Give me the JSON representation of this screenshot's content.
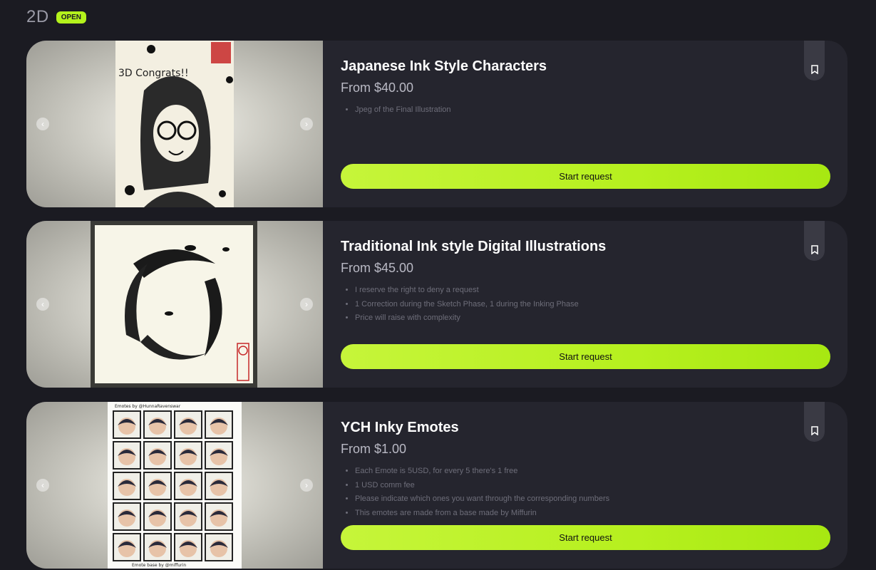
{
  "section": {
    "title": "2D",
    "status": "OPEN"
  },
  "colors": {
    "accent": "#b4f21c",
    "card_bg": "#25252e",
    "page_bg": "#1b1b22"
  },
  "cards": [
    {
      "title": "Japanese Ink Style Characters",
      "price": "From $40.00",
      "bullets": [
        "Jpeg of the Final Illustration"
      ],
      "cta": "Start request",
      "image_text": "3D Congrats!!"
    },
    {
      "title": "Traditional Ink style Digital Illustrations",
      "price": "From $45.00",
      "bullets": [
        "I reserve the right to deny a request",
        "1 Correction during the Sketch Phase, 1 during the Inking Phase",
        "Price will raise with complexity"
      ],
      "cta": "Start request"
    },
    {
      "title": "YCH Inky Emotes",
      "price": "From $1.00",
      "bullets": [
        "Each Emote is 5USD, for every 5 there's 1 free",
        "1 USD comm fee",
        "Please indicate which ones you want through the corresponding numbers",
        "This emotes are made from a base made by Miffurin"
      ],
      "cta": "Start request",
      "image_header": "Emotes by @HunnaRavenswar",
      "image_footer": "Emote base by @miffurin"
    }
  ],
  "icons": {
    "prev": "chevron-left-icon",
    "next": "chevron-right-icon",
    "bookmark": "bookmark-icon"
  }
}
